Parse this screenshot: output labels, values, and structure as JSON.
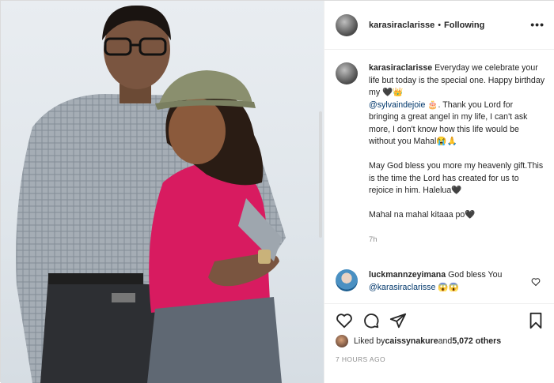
{
  "post": {
    "photo_alt": "Couple photo",
    "header": {
      "username": "karasiraclarisse",
      "separator": "•",
      "follow_label": "Following",
      "more_label": "•••"
    },
    "caption": {
      "username": "karasiraclarisse",
      "line1": " Everyday we celebrate your life but today is the special one. Happy birthday my 🖤👑",
      "mention": "@sylvaindejoie",
      "line2": " 🎂. Thank you Lord for bringing a great angel in my life, I can't ask more, I don't know how this life would be without you Mahal😭🙏",
      "para2": "May God bless you more my heavenly gift.This is the time the Lord has created for us to rejoice in him. Halelua🖤",
      "para3": "Mahal na mahal kitaaa po🖤",
      "time": "7h"
    },
    "comment": {
      "username": "luckmannzeyimana",
      "text_before": " God bless You ",
      "mention": "@karasiraclarisse",
      "text_after": " 😱😱"
    },
    "likes": {
      "prefix": "Liked by ",
      "user": "caissynakure",
      "middle": " and ",
      "count": "5,072 others"
    },
    "timestamp": "7 HOURS AGO"
  },
  "icons": {
    "heart": "heart-icon",
    "comment": "comment-icon",
    "share": "share-icon",
    "save": "bookmark-icon"
  },
  "colors": {
    "shirt": "#d81b60",
    "cap": "#8a8f6e",
    "mention": "#00376b"
  }
}
